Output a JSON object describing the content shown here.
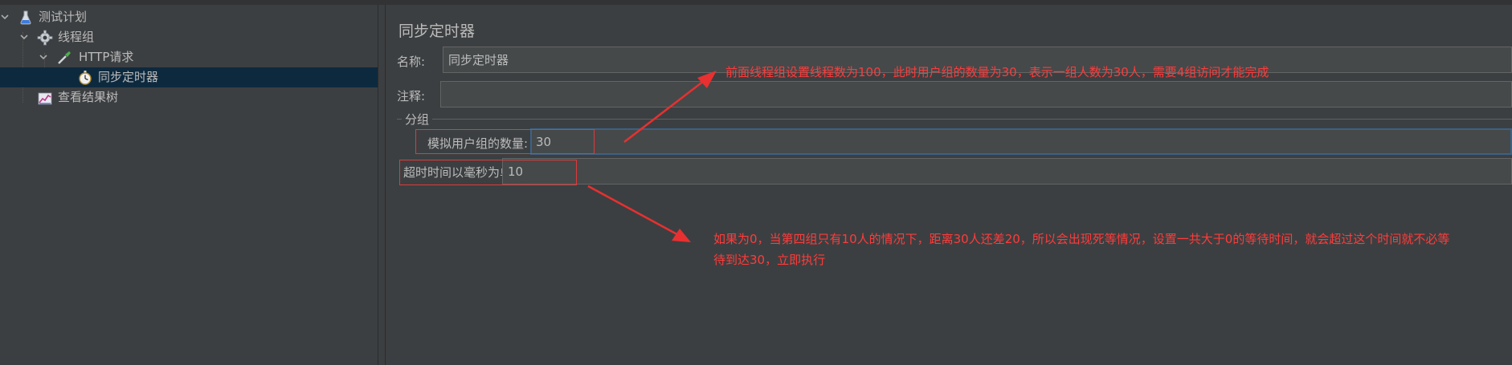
{
  "tree": {
    "items": [
      {
        "label": "测试计划",
        "icon": "flask-icon"
      },
      {
        "label": "线程组",
        "icon": "gear-icon"
      },
      {
        "label": "HTTP请求",
        "icon": "pipette-icon"
      },
      {
        "label": "同步定时器",
        "icon": "stopwatch-icon"
      },
      {
        "label": "查看结果树",
        "icon": "chart-icon"
      }
    ]
  },
  "panel": {
    "title": "同步定时器",
    "name_label": "名称:",
    "name_value": "同步定时器",
    "comment_label": "注释:",
    "comment_value": "",
    "group_title": "分组",
    "users_label": "模拟用户组的数量:",
    "users_value": "30",
    "timeout_label": "超时时间以毫秒为单位:",
    "timeout_value": "10"
  },
  "annotations": {
    "top": "前面线程组设置线程数为100，此时用户组的数量为30，表示一组人数为30人，需要4组访问才能完成",
    "bottom_line1": "如果为0，当第四组只有10人的情况下，距离30人还差20，所以会出现死等情况，设置一共大于0的等待时间，就会超过这个时间就不必等",
    "bottom_line2": "待到达30，立即执行"
  },
  "colors": {
    "background": "#3c3f41",
    "selection": "#0d293e",
    "annotation_red": "#ff3b3b",
    "focus_border": "#3d6185"
  }
}
